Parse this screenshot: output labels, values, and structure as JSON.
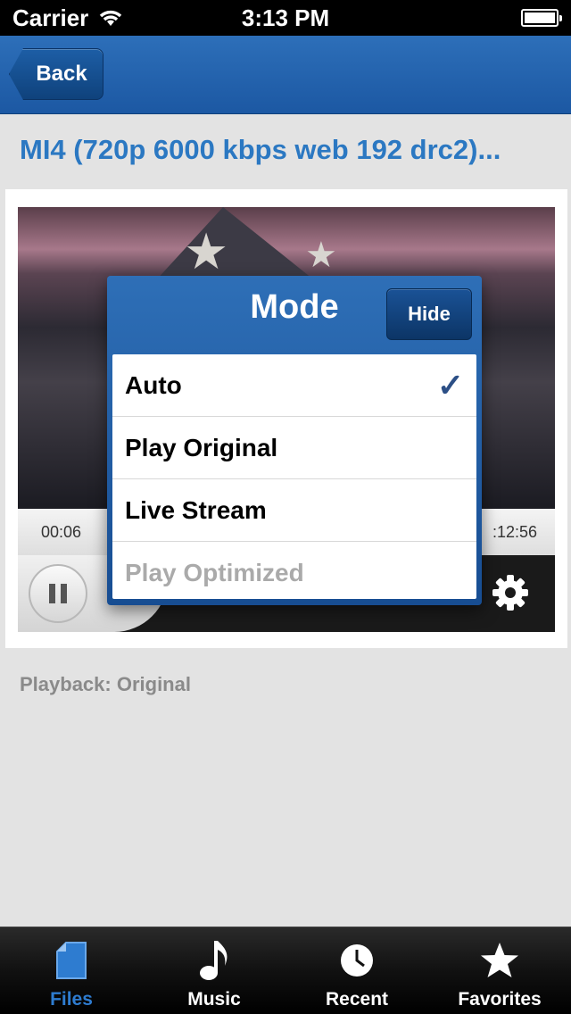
{
  "status_bar": {
    "carrier": "Carrier",
    "time": "3:13 PM",
    "wifi_icon": "wifi-icon",
    "battery_icon": "battery-icon"
  },
  "nav": {
    "back_label": "Back"
  },
  "title": "MI4 (720p 6000 kbps web 192 drc2)...",
  "player": {
    "elapsed": "00:06",
    "total": ":12:56",
    "pause_icon": "pause-icon",
    "gear_icon": "gear-icon",
    "shrink_icon": "shrink-icon"
  },
  "mode_popover": {
    "title": "Mode",
    "hide_label": "Hide",
    "items": [
      {
        "label": "Auto",
        "selected": true,
        "enabled": true
      },
      {
        "label": "Play Original",
        "selected": false,
        "enabled": true
      },
      {
        "label": "Live Stream",
        "selected": false,
        "enabled": true
      },
      {
        "label": "Play Optimized",
        "selected": false,
        "enabled": false
      }
    ],
    "check_glyph": "✓"
  },
  "playback_status": "Playback: Original",
  "tab_bar": {
    "tabs": [
      {
        "label": "Files",
        "icon": "file-icon",
        "active": true
      },
      {
        "label": "Music",
        "icon": "music-note-icon",
        "active": false
      },
      {
        "label": "Recent",
        "icon": "clock-icon",
        "active": false
      },
      {
        "label": "Favorites",
        "icon": "star-icon",
        "active": false
      }
    ]
  },
  "colors": {
    "accent": "#2b78c2",
    "nav_blue": "#1c58a3",
    "active_tab": "#2e7cd0"
  }
}
